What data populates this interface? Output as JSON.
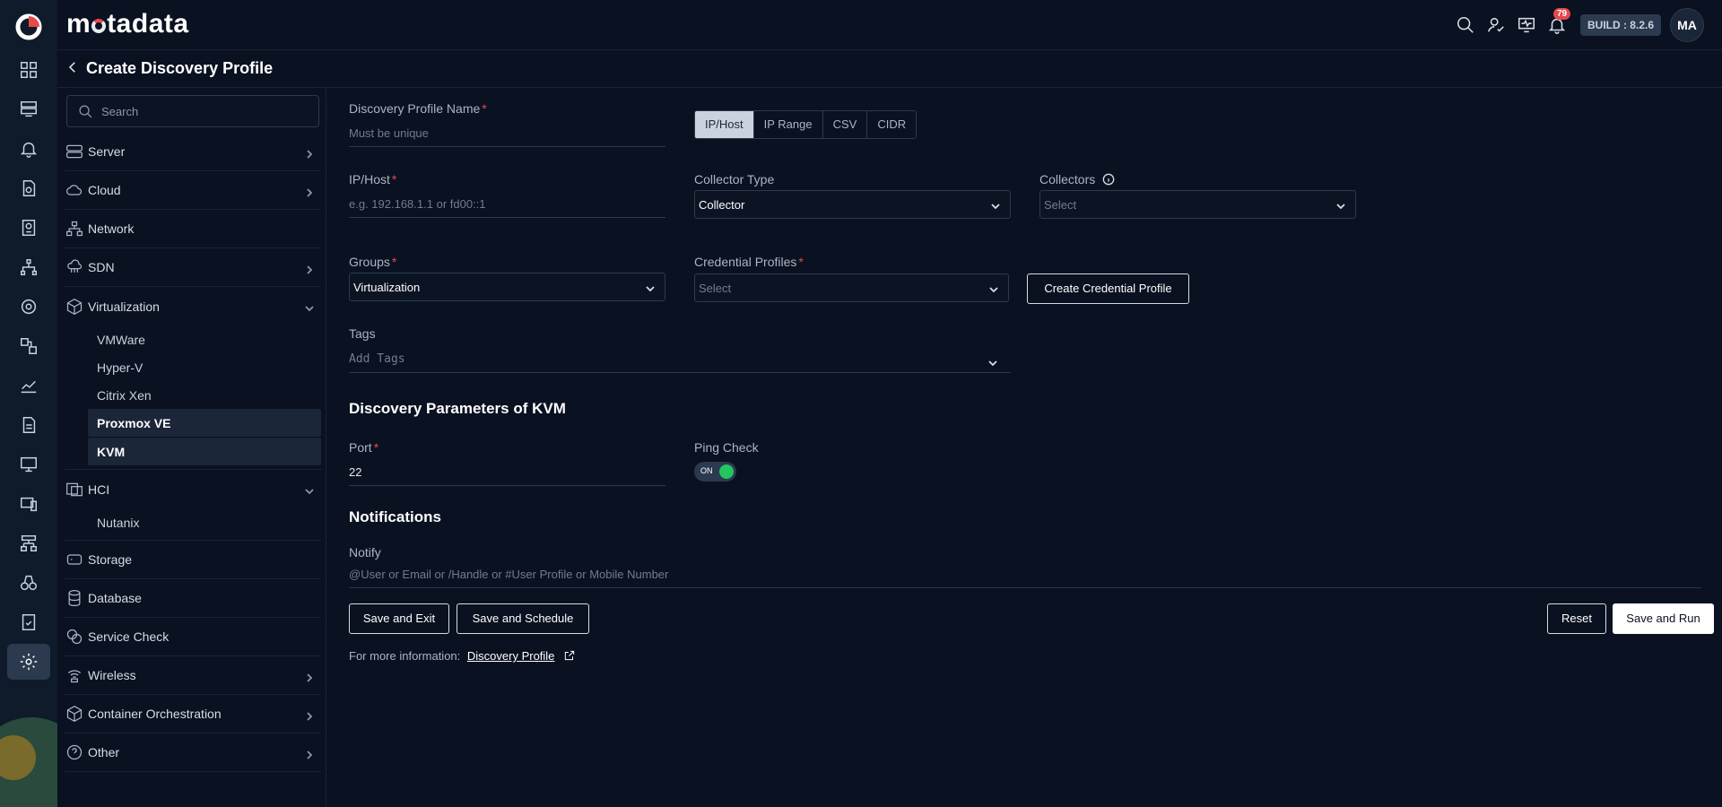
{
  "brand": {
    "name_pre": "m",
    "name_post": "tadata"
  },
  "topbar": {
    "notification_count": "79",
    "build_label": "BUILD : 8.2.6",
    "avatar_initials": "MA",
    "icons": [
      "search-icon",
      "user-check-icon",
      "monitor-pulse-icon",
      "bell-icon"
    ]
  },
  "page": {
    "title": "Create Discovery Profile"
  },
  "sidebar": {
    "search_placeholder": "Search",
    "items": [
      {
        "label": "Server",
        "icon": "server-icon",
        "expandable": true
      },
      {
        "label": "Cloud",
        "icon": "cloud-icon",
        "expandable": true
      },
      {
        "label": "Network",
        "icon": "network-icon",
        "expandable": false
      },
      {
        "label": "SDN",
        "icon": "sdn-icon",
        "expandable": true
      },
      {
        "label": "Virtualization",
        "icon": "cube-icon",
        "expandable": true,
        "expanded": true,
        "children": [
          "VMWare",
          "Hyper-V",
          "Citrix Xen",
          "Proxmox VE",
          "KVM"
        ]
      },
      {
        "label": "HCI",
        "icon": "hci-icon",
        "expandable": true,
        "expanded": true,
        "children": [
          "Nutanix"
        ]
      },
      {
        "label": "Storage",
        "icon": "storage-icon",
        "expandable": false
      },
      {
        "label": "Database",
        "icon": "database-icon",
        "expandable": false
      },
      {
        "label": "Service Check",
        "icon": "service-check-icon",
        "expandable": false
      },
      {
        "label": "Wireless",
        "icon": "wireless-icon",
        "expandable": true
      },
      {
        "label": "Container Orchestration",
        "icon": "container-icon",
        "expandable": true
      },
      {
        "label": "Other",
        "icon": "help-circle-icon",
        "expandable": true
      }
    ],
    "highlighted_children": [
      "Proxmox VE",
      "KVM"
    ]
  },
  "form": {
    "profile_name": {
      "label": "Discovery Profile Name",
      "placeholder": "Must be unique"
    },
    "input_type_tabs": [
      "IP/Host",
      "IP Range",
      "CSV",
      "CIDR"
    ],
    "input_type_selected": "IP/Host",
    "ip_host": {
      "label": "IP/Host",
      "placeholder": "e.g. 192.168.1.1 or fd00::1"
    },
    "collector_type": {
      "label": "Collector Type",
      "value": "Collector"
    },
    "collectors": {
      "label": "Collectors",
      "placeholder": "Select"
    },
    "groups": {
      "label": "Groups",
      "value": "Virtualization"
    },
    "credential_profiles": {
      "label": "Credential Profiles",
      "placeholder": "Select"
    },
    "create_credential_button": "Create Credential Profile",
    "tags": {
      "label": "Tags",
      "placeholder": "Add Tags"
    },
    "params_title": "Discovery Parameters of KVM",
    "port": {
      "label": "Port",
      "value": "22"
    },
    "ping_check": {
      "label": "Ping Check",
      "state": "ON"
    },
    "notifications_title": "Notifications",
    "notify": {
      "label": "Notify",
      "placeholder": "@User or Email or /Handle or #User Profile or Mobile Number"
    },
    "buttons": {
      "save_exit": "Save and Exit",
      "save_schedule": "Save and Schedule",
      "reset": "Reset",
      "save_run": "Save and Run"
    },
    "more_info": {
      "text": "For more information:",
      "link": "Discovery Profile"
    }
  },
  "colors": {
    "background": "#0a1120",
    "rail": "#0f1a2b",
    "required": "#e5484d",
    "toggle_on": "#22c55e",
    "badge": "#e5484d"
  }
}
